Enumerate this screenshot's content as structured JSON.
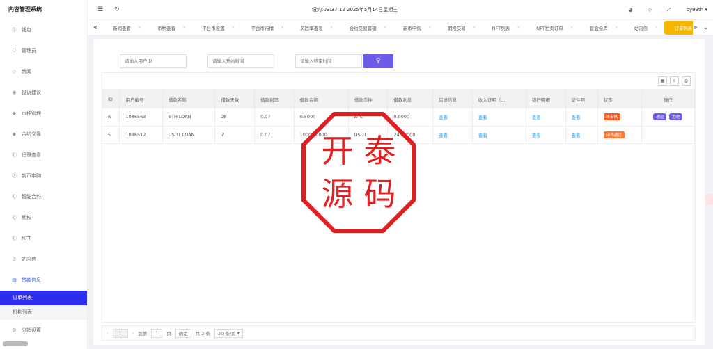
{
  "sidebar": {
    "title": "内容管理系统",
    "items": [
      {
        "label": "钱包",
        "icon": "dollar-circle-icon"
      },
      {
        "label": "管理员",
        "icon": "shield-icon"
      },
      {
        "label": "新闻",
        "icon": "tag-icon"
      },
      {
        "label": "投诉建议",
        "icon": "eye-icon"
      },
      {
        "label": "币种管理",
        "icon": "diamond-icon"
      },
      {
        "label": "合约交易",
        "icon": "diamond-icon"
      },
      {
        "label": "记录查看",
        "icon": "circle-c-icon"
      },
      {
        "label": "新币申购",
        "icon": "dollar-circle-icon"
      },
      {
        "label": "智能合约",
        "icon": "circle-c-icon"
      },
      {
        "label": "期权",
        "icon": "circle-c-icon"
      },
      {
        "label": "NFT",
        "icon": "circle-c-icon"
      },
      {
        "label": "站内信",
        "icon": "bell-icon"
      },
      {
        "label": "贷款信息",
        "icon": "list-icon"
      }
    ],
    "submenu": [
      {
        "label": "订单列表",
        "active": true
      },
      {
        "label": "机构列表",
        "active": false
      }
    ],
    "last_item": {
      "label": "分销设置",
      "icon": "gear-icon"
    }
  },
  "header": {
    "datetime": "纽约:09:37:12 2025年5月14日星期三",
    "user": "by99th"
  },
  "tabs": [
    {
      "label": "新闻查看"
    },
    {
      "label": "币种查看"
    },
    {
      "label": "平台币设置"
    },
    {
      "label": "平台币行情"
    },
    {
      "label": "风险率查看"
    },
    {
      "label": "合约交易管理"
    },
    {
      "label": "新币申购"
    },
    {
      "label": "期权交易"
    },
    {
      "label": "NFT列表"
    },
    {
      "label": "NFT拍卖订单"
    },
    {
      "label": "盲盒仓库"
    },
    {
      "label": "站内信"
    },
    {
      "label": "订单列表",
      "active": true
    }
  ],
  "search": {
    "user_id_placeholder": "请输入用户ID",
    "start_placeholder": "请输入开始时间",
    "end_placeholder": "请输入结束时间"
  },
  "table": {
    "headers": [
      "ID",
      "用户编号",
      "借款名称",
      "借款天数",
      "借款利率",
      "借款金额",
      "借款币种",
      "借款利息",
      "房屋信息",
      "收入证明（...",
      "银行明细",
      "证件照",
      "状态",
      "操作"
    ],
    "rows": [
      {
        "id": "6",
        "user": "1086563",
        "name": "ETH LOAN",
        "days": "28",
        "rate": "0.07",
        "amount": "0.5000",
        "coin": "BTC",
        "interest": "0.0000",
        "house": "查看",
        "income": "查看",
        "bank": "查看",
        "idphoto": "查看",
        "status": "未审核",
        "status_color": "#ff5722",
        "ops": [
          "通过",
          "拒绝"
        ]
      },
      {
        "id": "5",
        "user": "1086512",
        "name": "USDT LOAN",
        "days": "7",
        "rate": "0.07",
        "amount": "10000.0000",
        "coin": "USDT",
        "interest": "245.0000",
        "house": "查看",
        "income": "查看",
        "bank": "查看",
        "idphoto": "查看",
        "status": "审核通过",
        "status_color": "#ff7733",
        "ops": []
      }
    ]
  },
  "pager": {
    "current": "1",
    "goto_label": "到第",
    "goto_value": "1",
    "page_unit": "页",
    "confirm": "确定",
    "total": "共 2 条",
    "size": "20 条/页"
  },
  "watermark": {
    "chars": [
      "开",
      "泰",
      "源",
      "码"
    ]
  }
}
